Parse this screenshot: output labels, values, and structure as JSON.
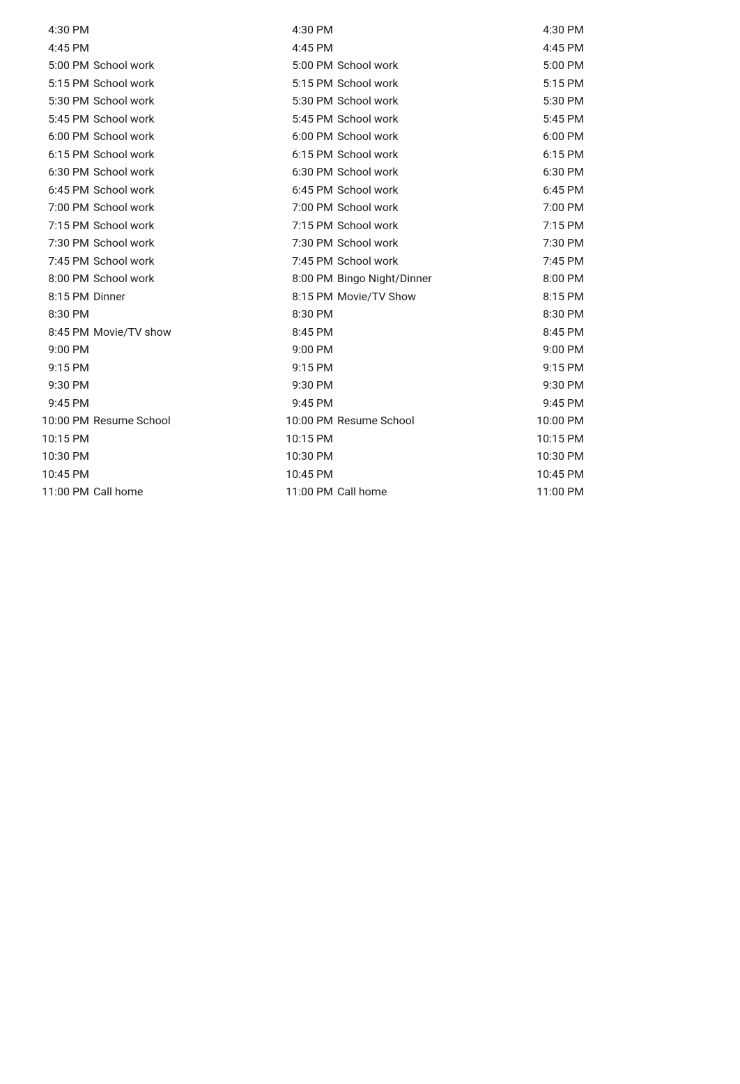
{
  "schedule": {
    "col1": [
      {
        "time": "4:30 PM",
        "activity": ""
      },
      {
        "time": "4:45 PM",
        "activity": ""
      },
      {
        "time": "5:00 PM",
        "activity": "School work"
      },
      {
        "time": "5:15 PM",
        "activity": "School work"
      },
      {
        "time": "5:30 PM",
        "activity": "School work"
      },
      {
        "time": "5:45 PM",
        "activity": "School work"
      },
      {
        "time": "6:00 PM",
        "activity": "School work"
      },
      {
        "time": "6:15 PM",
        "activity": "School work"
      },
      {
        "time": "6:30 PM",
        "activity": "School work"
      },
      {
        "time": "6:45 PM",
        "activity": "School work"
      },
      {
        "time": "7:00 PM",
        "activity": "School work"
      },
      {
        "time": "7:15 PM",
        "activity": "School work"
      },
      {
        "time": "7:30 PM",
        "activity": "School work"
      },
      {
        "time": "7:45 PM",
        "activity": "School work"
      },
      {
        "time": "8:00 PM",
        "activity": "School work"
      },
      {
        "time": "8:15 PM",
        "activity": "Dinner"
      },
      {
        "time": "8:30 PM",
        "activity": ""
      },
      {
        "time": "8:45 PM",
        "activity": "Movie/TV show"
      },
      {
        "time": "9:00 PM",
        "activity": ""
      },
      {
        "time": "9:15 PM",
        "activity": ""
      },
      {
        "time": "9:30 PM",
        "activity": ""
      },
      {
        "time": "9:45 PM",
        "activity": ""
      },
      {
        "time": "10:00 PM",
        "activity": "Resume School"
      },
      {
        "time": "10:15 PM",
        "activity": ""
      },
      {
        "time": "10:30 PM",
        "activity": ""
      },
      {
        "time": "10:45 PM",
        "activity": ""
      },
      {
        "time": "11:00 PM",
        "activity": "Call home"
      }
    ],
    "col2": [
      {
        "time": "4:30 PM",
        "activity": ""
      },
      {
        "time": "4:45 PM",
        "activity": ""
      },
      {
        "time": "5:00 PM",
        "activity": "School work"
      },
      {
        "time": "5:15 PM",
        "activity": "School work"
      },
      {
        "time": "5:30 PM",
        "activity": "School work"
      },
      {
        "time": "5:45 PM",
        "activity": "School work"
      },
      {
        "time": "6:00 PM",
        "activity": "School work"
      },
      {
        "time": "6:15 PM",
        "activity": "School work"
      },
      {
        "time": "6:30 PM",
        "activity": "School work"
      },
      {
        "time": "6:45 PM",
        "activity": "School work"
      },
      {
        "time": "7:00 PM",
        "activity": "School work"
      },
      {
        "time": "7:15 PM",
        "activity": "School work"
      },
      {
        "time": "7:30 PM",
        "activity": "School work"
      },
      {
        "time": "7:45 PM",
        "activity": "School work"
      },
      {
        "time": "8:00 PM",
        "activity": "Bingo Night/Dinner"
      },
      {
        "time": "8:15 PM",
        "activity": "Movie/TV Show"
      },
      {
        "time": "8:30 PM",
        "activity": ""
      },
      {
        "time": "8:45 PM",
        "activity": ""
      },
      {
        "time": "9:00 PM",
        "activity": ""
      },
      {
        "time": "9:15 PM",
        "activity": ""
      },
      {
        "time": "9:30 PM",
        "activity": ""
      },
      {
        "time": "9:45 PM",
        "activity": ""
      },
      {
        "time": "10:00 PM",
        "activity": "Resume School"
      },
      {
        "time": "10:15 PM",
        "activity": ""
      },
      {
        "time": "10:30 PM",
        "activity": ""
      },
      {
        "time": "10:45 PM",
        "activity": ""
      },
      {
        "time": "11:00 PM",
        "activity": "Call home"
      }
    ],
    "col3": [
      {
        "time": "4:30 PM"
      },
      {
        "time": "4:45 PM"
      },
      {
        "time": "5:00 PM"
      },
      {
        "time": "5:15 PM"
      },
      {
        "time": "5:30 PM"
      },
      {
        "time": "5:45 PM"
      },
      {
        "time": "6:00 PM"
      },
      {
        "time": "6:15 PM"
      },
      {
        "time": "6:30 PM"
      },
      {
        "time": "6:45 PM"
      },
      {
        "time": "7:00 PM"
      },
      {
        "time": "7:15 PM"
      },
      {
        "time": "7:30 PM"
      },
      {
        "time": "7:45 PM"
      },
      {
        "time": "8:00 PM"
      },
      {
        "time": "8:15 PM"
      },
      {
        "time": "8:30 PM"
      },
      {
        "time": "8:45 PM"
      },
      {
        "time": "9:00 PM"
      },
      {
        "time": "9:15 PM"
      },
      {
        "time": "9:30 PM"
      },
      {
        "time": "9:45 PM"
      },
      {
        "time": "10:00 PM"
      },
      {
        "time": "10:15 PM"
      },
      {
        "time": "10:30 PM"
      },
      {
        "time": "10:45 PM"
      },
      {
        "time": "11:00 PM"
      }
    ]
  }
}
